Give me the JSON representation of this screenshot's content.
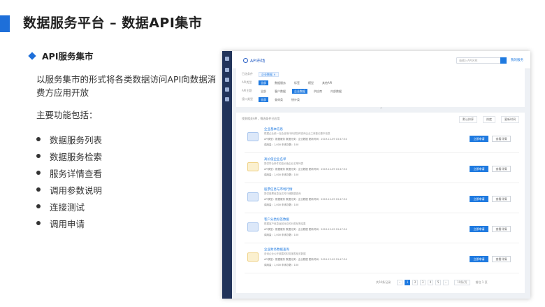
{
  "slide": {
    "title": "数据服务平台 – 数据API集市",
    "section_title": "API服务集市",
    "intro": "以服务集市的形式将各类数据访问API向数据消费方应用开放",
    "features_heading": "主要功能包括：",
    "features": [
      "数据服务列表",
      "数据服务检索",
      "服务详情查看",
      "调用参数说明",
      "连接测试",
      "调用申请"
    ]
  },
  "screenshot": {
    "app_name": "API市场",
    "search_placeholder": "请输入API名称",
    "top_link": "我的服务",
    "filters": {
      "selected_label": "已选条件",
      "selected_tag": "企业数据 ×",
      "row1_label": "API类型",
      "row1": [
        "全部",
        "数据服务",
        "标签",
        "模型",
        "其他API"
      ],
      "row2_label": "API主题",
      "row2": [
        "全部",
        "客户数据",
        "企业数据",
        "供应商",
        "内部数据"
      ],
      "row3_label": "接口类型",
      "row3": [
        "全部",
        "查询类",
        "统计类"
      ]
    },
    "list_header": "找到相关API，筛选条件已应用",
    "sorts": [
      "默认排序",
      "热度",
      "更新时间"
    ],
    "items": [
      {
        "name": "企业基本信息",
        "desc": "根据企业统一社会信用代码或名称查询企业工商登记基本信息",
        "meta1": "API类型：数据服务    数据分类：企业数据    更新时间：2019-12-09 15:47:34",
        "meta2": "调用量：1,000    申请次数：100",
        "icon": "blue"
      },
      {
        "name": "高价值企业名单",
        "desc": "提供符合条件的高价值企业名单列表",
        "meta1": "API类型：数据服务    数据分类：企业数据    更新时间：2019-12-09 15:47:34",
        "meta2": "调用量：1,000    申请次数：100",
        "icon": "yellow"
      },
      {
        "name": "股票信息与市场行情",
        "desc": "提供股票信息及实时行情数据查询",
        "meta1": "API类型：数据服务    数据分类：企业数据    更新时间：2019-12-09 15:47:34",
        "meta2": "调用量：1,000    申请次数：100",
        "icon": "blue"
      },
      {
        "name": "客户分类标签数据",
        "desc": "根据客户信息返回对应的分类标签结果",
        "meta1": "API类型：数据服务    数据分类：企业数据    更新时间：2019-12-09 15:47:34",
        "meta2": "调用量：1,000    申请次数：100",
        "icon": "blue"
      },
      {
        "name": "企业财务数据查询",
        "desc": "查询企业公开披露的财务报表相关数据",
        "meta1": "API类型：数据服务    数据分类：企业数据    更新时间：2019-12-09 15:47:34",
        "meta2": "调用量：1,000    申请次数：100",
        "icon": "yellow"
      }
    ],
    "apply_label": "立即申请",
    "detail_label": "查看详情",
    "pager": {
      "total": "共50条记录",
      "pages": [
        "‹",
        "1",
        "2",
        "3",
        "4",
        "5",
        "›"
      ],
      "page_size": "10条/页",
      "goto": "前往 1 页"
    }
  }
}
